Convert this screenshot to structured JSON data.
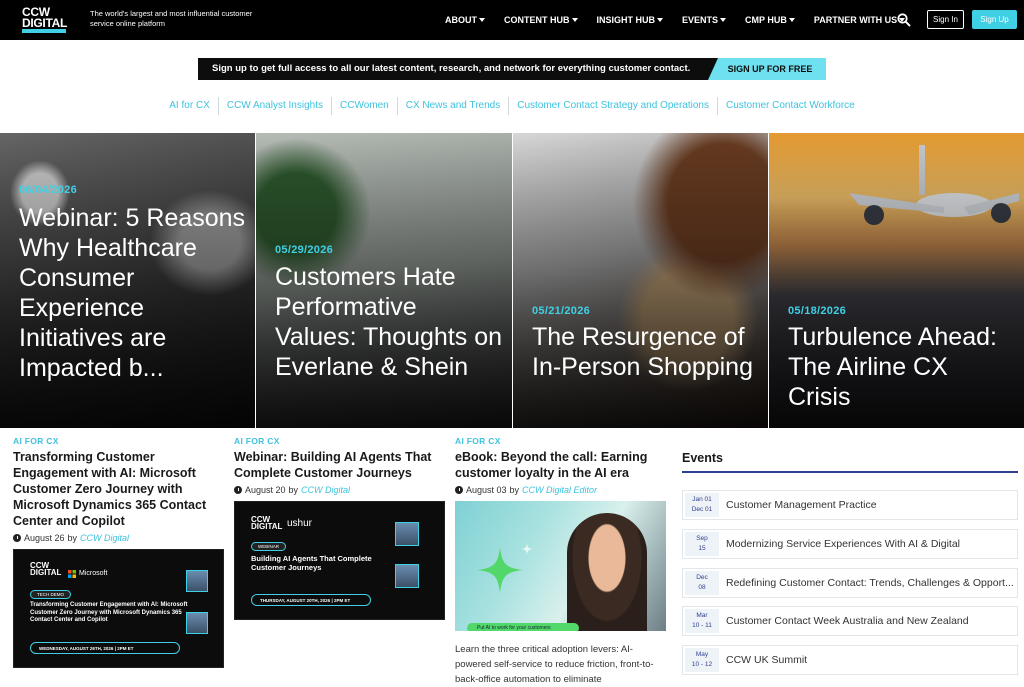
{
  "header": {
    "logo_line1": "CCW",
    "logo_line2": "DIGITAL",
    "tagline": "The world's largest and most influential customer service online platform",
    "nav": [
      "ABOUT",
      "CONTENT HUB",
      "INSIGHT HUB",
      "EVENTS",
      "CMP HUB",
      "PARTNER WITH US"
    ],
    "signin_label": "Sign In",
    "signup_label": "Sign Up"
  },
  "promo": {
    "text": "Sign up to get full access to all our latest content, research, and network for everything customer contact.",
    "cta": "SIGN UP FOR FREE"
  },
  "categories": [
    "AI for CX",
    "CCW Analyst Insights",
    "CCWomen",
    "CX News and Trends",
    "Customer Contact Strategy and Operations",
    "Customer Contact Workforce"
  ],
  "hero": [
    {
      "date": "06/04/2026",
      "title": "Webinar: 5 Reasons Why Healthcare Consumer Experience Initiatives are Impacted b..."
    },
    {
      "date": "05/29/2026",
      "title": "Customers Hate Performative Values: Thoughts on Everlane & Shein"
    },
    {
      "date": "05/21/2026",
      "title": "The Resurgence of In-Person Shopping"
    },
    {
      "date": "05/18/2026",
      "title": "Turbulence Ahead: The Airline CX Crisis"
    }
  ],
  "articles": [
    {
      "tag": "AI FOR CX",
      "title": "Transforming Customer Engagement with AI: Microsoft Customer Zero Journey with Microsoft Dynamics 365 Contact Center and Copilot",
      "date": "August 26",
      "by": "by",
      "author": "CCW Digital",
      "thumb": {
        "brand2": "Microsoft",
        "pill": "TECH DEMO",
        "headline": "Transforming Customer Engagement with AI: Microsoft Customer Zero Journey with Microsoft Dynamics 365 Contact Center and Copilot",
        "bar": "WEDNESDAY, AUGUST 26TH, 2026 | 2PM ET"
      }
    },
    {
      "tag": "AI FOR CX",
      "title": "Webinar: Building AI Agents That Complete Customer Journeys",
      "date": "August 20",
      "by": "by",
      "author": "CCW Digital",
      "thumb": {
        "brand2": "ushur",
        "pill": "WEBINAR",
        "headline": "Building AI Agents That Complete Customer Journeys",
        "bar": "THURSDAY, AUGUST 20TH, 2026 | 2PM ET"
      }
    },
    {
      "tag": "AI FOR CX",
      "title": "eBook: Beyond the call: Earning customer loyalty in the AI era",
      "date": "August 03",
      "by": "by",
      "author": "CCW Digital Editor",
      "desc": "Learn the three critical adoption levers: AI-powered self-service to reduce friction, front-to-back-office automation to eliminate",
      "thumb": {
        "caption": "Put AI to work for your customers"
      }
    }
  ],
  "events": {
    "title": "Events",
    "items": [
      {
        "d1": "Jan 01",
        "d2": "Dec 01",
        "name": "Customer Management Practice"
      },
      {
        "d1": "Sep",
        "d2": "15",
        "name": "Modernizing Service Experiences With AI & Digital"
      },
      {
        "d1": "Dec",
        "d2": "08",
        "name": "Redefining Customer Contact: Trends, Challenges & Opport..."
      },
      {
        "d1": "Mar",
        "d2": "10 - 11",
        "name": "Customer Contact Week Australia and New Zealand"
      },
      {
        "d1": "May",
        "d2": "10 - 12",
        "name": "CCW UK Summit"
      }
    ]
  }
}
